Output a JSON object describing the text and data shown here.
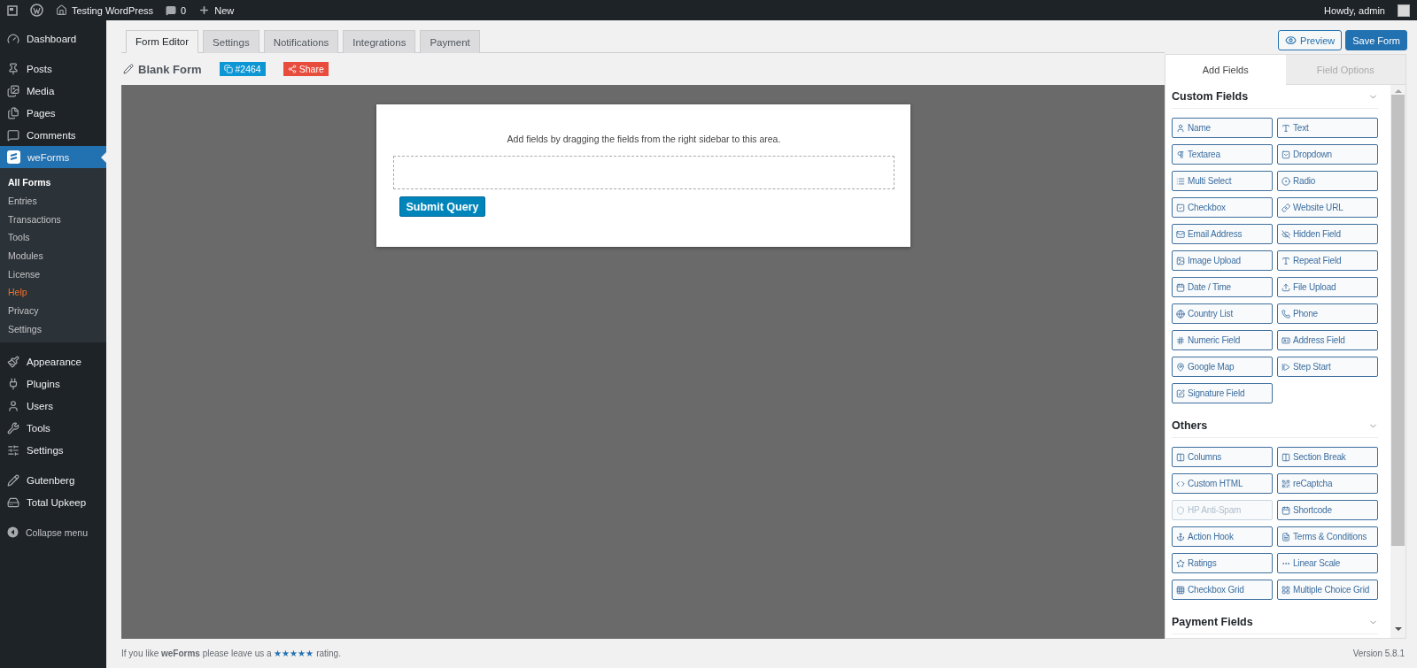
{
  "admin_bar": {
    "site_name": "Testing WordPress",
    "comments_count": "0",
    "new_label": "New",
    "greeting": "Howdy, admin"
  },
  "sidebar": {
    "groups": [
      {
        "items": [
          {
            "label": "Dashboard",
            "selected": false
          }
        ]
      },
      {
        "items": [
          {
            "label": "Posts",
            "selected": false
          },
          {
            "label": "Media",
            "selected": false
          },
          {
            "label": "Pages",
            "selected": false
          },
          {
            "label": "Comments",
            "selected": false
          },
          {
            "label": "weForms",
            "selected": true,
            "children": [
              {
                "label": "All Forms",
                "selected": true,
                "highlight": false
              },
              {
                "label": "Entries",
                "selected": false,
                "highlight": false
              },
              {
                "label": "Transactions",
                "selected": false,
                "highlight": false
              },
              {
                "label": "Tools",
                "selected": false,
                "highlight": false
              },
              {
                "label": "Modules",
                "selected": false,
                "highlight": false
              },
              {
                "label": "License",
                "selected": false,
                "highlight": false
              },
              {
                "label": "Help",
                "selected": false,
                "highlight": true
              },
              {
                "label": "Privacy",
                "selected": false,
                "highlight": false
              },
              {
                "label": "Settings",
                "selected": false,
                "highlight": false
              }
            ]
          }
        ]
      },
      {
        "items": [
          {
            "label": "Appearance",
            "selected": false
          },
          {
            "label": "Plugins",
            "selected": false
          },
          {
            "label": "Users",
            "selected": false
          },
          {
            "label": "Tools",
            "selected": false
          },
          {
            "label": "Settings",
            "selected": false
          }
        ]
      },
      {
        "items": [
          {
            "label": "Gutenberg",
            "selected": false
          },
          {
            "label": "Total Upkeep",
            "selected": false
          }
        ]
      }
    ],
    "collapse_label": "Collapse menu"
  },
  "tabs": [
    {
      "label": "Form Editor",
      "selected": true
    },
    {
      "label": "Settings",
      "selected": false
    },
    {
      "label": "Notifications",
      "selected": false
    },
    {
      "label": "Integrations",
      "selected": false
    },
    {
      "label": "Payment",
      "selected": false
    }
  ],
  "actions": {
    "preview": "Preview",
    "save": "Save Form"
  },
  "form": {
    "title": "Blank Form",
    "id_badge": "#2464",
    "share_label": "Share",
    "hint": "Add fields by dragging the fields from the right sidebar to this area.",
    "submit_label": "Submit Query"
  },
  "panel": {
    "tabs": [
      {
        "label": "Add Fields",
        "selected": true
      },
      {
        "label": "Field Options",
        "selected": false
      }
    ],
    "sections": [
      {
        "title": "Custom Fields",
        "fields": [
          {
            "label": "Name",
            "disabled": false
          },
          {
            "label": "Text",
            "disabled": false
          },
          {
            "label": "Textarea",
            "disabled": false
          },
          {
            "label": "Dropdown",
            "disabled": false
          },
          {
            "label": "Multi Select",
            "disabled": false
          },
          {
            "label": "Radio",
            "disabled": false
          },
          {
            "label": "Checkbox",
            "disabled": false
          },
          {
            "label": "Website URL",
            "disabled": false
          },
          {
            "label": "Email Address",
            "disabled": false
          },
          {
            "label": "Hidden Field",
            "disabled": false
          },
          {
            "label": "Image Upload",
            "disabled": false
          },
          {
            "label": "Repeat Field",
            "disabled": false
          },
          {
            "label": "Date / Time",
            "disabled": false
          },
          {
            "label": "File Upload",
            "disabled": false
          },
          {
            "label": "Country List",
            "disabled": false
          },
          {
            "label": "Phone",
            "disabled": false
          },
          {
            "label": "Numeric Field",
            "disabled": false
          },
          {
            "label": "Address Field",
            "disabled": false
          },
          {
            "label": "Google Map",
            "disabled": false
          },
          {
            "label": "Step Start",
            "disabled": false
          },
          {
            "label": "Signature Field",
            "disabled": false
          }
        ]
      },
      {
        "title": "Others",
        "fields": [
          {
            "label": "Columns",
            "disabled": false
          },
          {
            "label": "Section Break",
            "disabled": false
          },
          {
            "label": "Custom HTML",
            "disabled": false
          },
          {
            "label": "reCaptcha",
            "disabled": false
          },
          {
            "label": "HP Anti-Spam",
            "disabled": true
          },
          {
            "label": "Shortcode",
            "disabled": false
          },
          {
            "label": "Action Hook",
            "disabled": false
          },
          {
            "label": "Terms & Conditions",
            "disabled": false
          },
          {
            "label": "Ratings",
            "disabled": false
          },
          {
            "label": "Linear Scale",
            "disabled": false
          },
          {
            "label": "Checkbox Grid",
            "disabled": false
          },
          {
            "label": "Multiple Choice Grid",
            "disabled": false
          }
        ]
      },
      {
        "title": "Payment Fields"
      }
    ]
  },
  "footer": {
    "text": "If you like **weForms** please leave us a",
    "link": "★★★★★",
    "after": "rating.",
    "version": "Version 5.8.1"
  }
}
